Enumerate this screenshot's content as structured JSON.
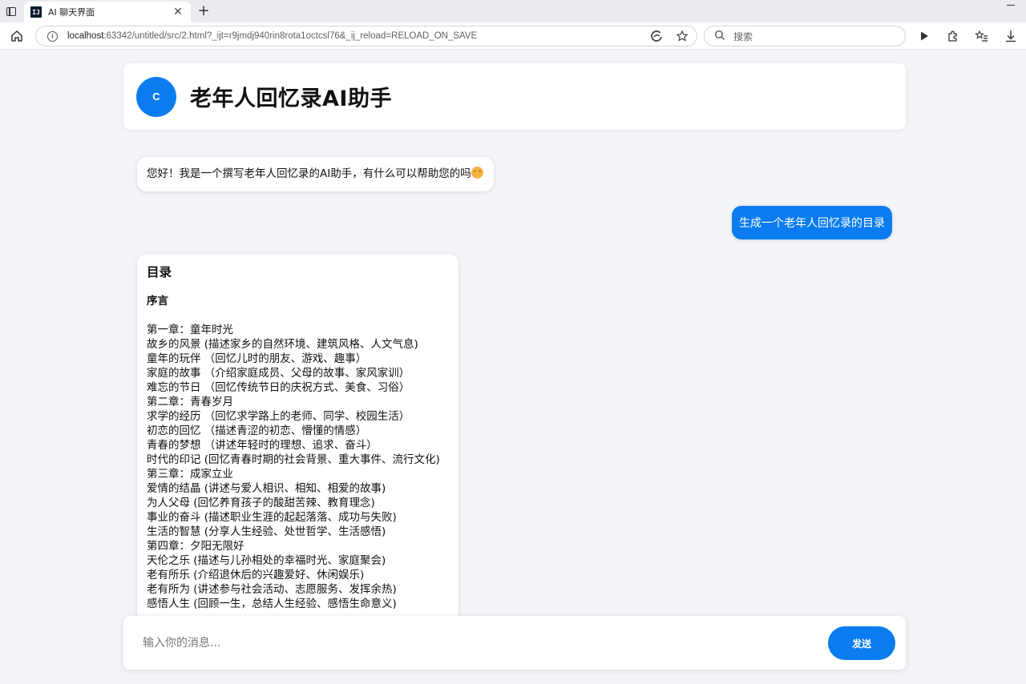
{
  "browser": {
    "tab_title": "AI 聊天界面",
    "tab_favicon_text": "IJ",
    "url_host": "localhost",
    "url_rest": ":63342/untitled/src/2.html?_ijt=r9jmdj940rin8rota1octcsl76&_ij_reload=RELOAD_ON_SAVE",
    "search_placeholder": "搜索"
  },
  "header": {
    "avatar_letter": "C",
    "title": "老年人回忆录AI助手"
  },
  "messages": {
    "greeting": "您好！我是一个撰写老年人回忆录的AI助手，有什么可以帮助您的吗",
    "user_request": "生成一个老年人回忆录的目录",
    "toc": {
      "heading": "目录",
      "preface": "序言",
      "lines": [
        "第一章：童年时光",
        "故乡的风景 (描述家乡的自然环境、建筑风格、人文气息)",
        "童年的玩伴 （回忆儿时的朋友、游戏、趣事）",
        "家庭的故事 （介绍家庭成员、父母的故事、家风家训）",
        "难忘的节日 （回忆传统节日的庆祝方式、美食、习俗）",
        "第二章：青春岁月",
        "求学的经历 （回忆求学路上的老师、同学、校园生活）",
        "初恋的回忆 （描述青涩的初恋、懵懂的情感）",
        "青春的梦想 （讲述年轻时的理想、追求、奋斗）",
        "时代的印记 (回忆青春时期的社会背景、重大事件、流行文化)",
        "第三章：成家立业",
        "爱情的结晶 (讲述与爱人相识、相知、相爱的故事)",
        "为人父母 (回忆养育孩子的酸甜苦辣、教育理念)",
        "事业的奋斗 (描述职业生涯的起起落落、成功与失败)",
        "生活的智慧 (分享人生经验、处世哲学、生活感悟)",
        "第四章：夕阳无限好",
        "天伦之乐 (描述与儿孙相处的幸福时光、家庭聚会)",
        "老有所乐 (介绍退休后的兴趣爱好、休闲娱乐)",
        "老有所为 (讲述参与社会活动、志愿服务、发挥余热)",
        "感悟人生 (回顾一生，总结人生经验、感悟生命意义)"
      ]
    }
  },
  "composer": {
    "placeholder": "输入你的消息...",
    "send_label": "发送"
  },
  "colors": {
    "accent": "#0a7cf0",
    "background": "#f3f5f9"
  }
}
